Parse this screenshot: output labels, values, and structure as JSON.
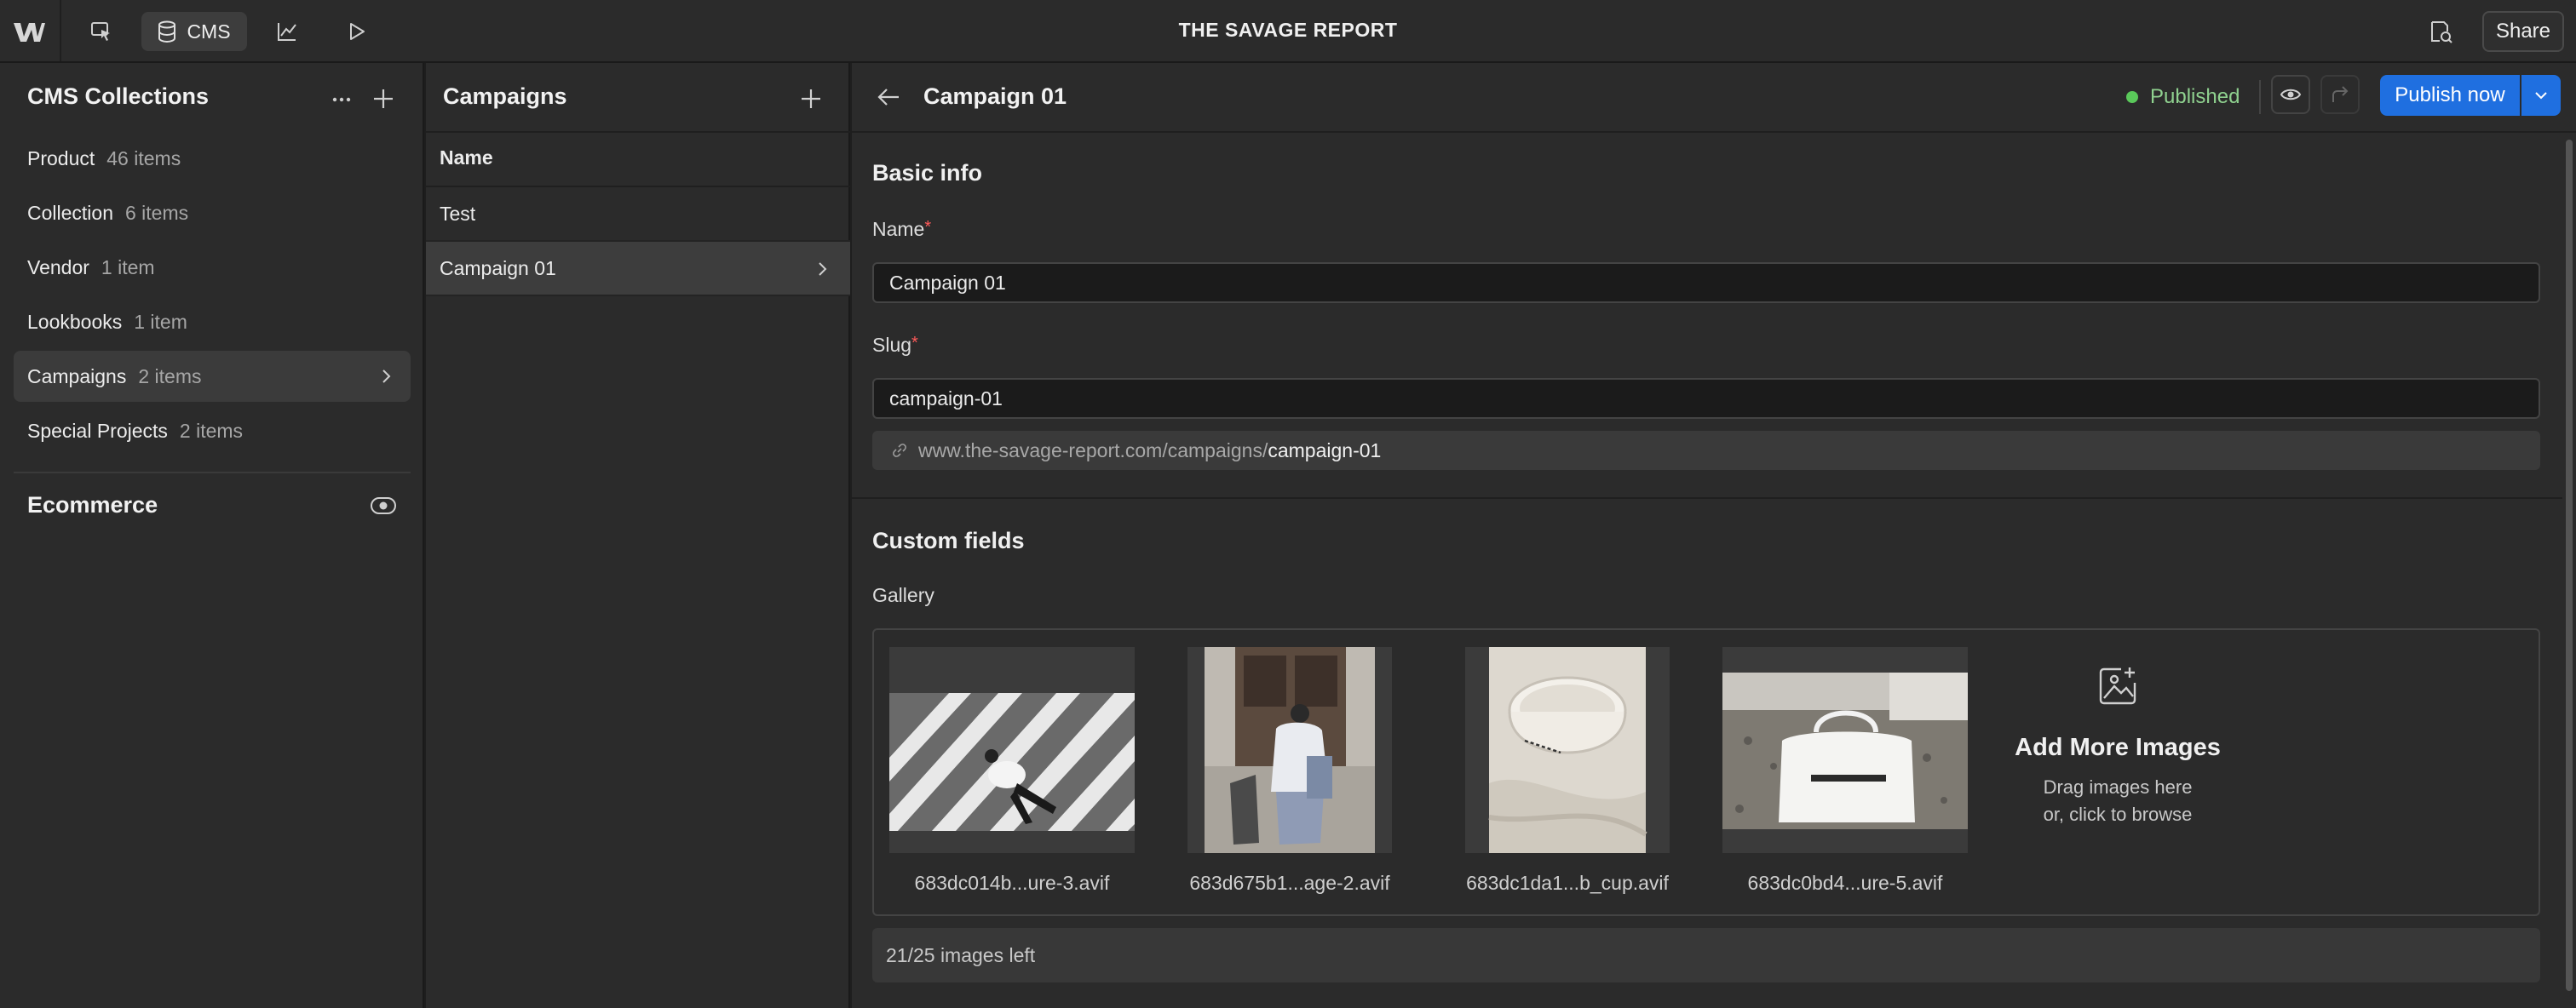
{
  "topbar": {
    "title": "THE SAVAGE REPORT",
    "cms_label": "CMS",
    "share_label": "Share",
    "icons": [
      "webflow-logo",
      "pointer-icon",
      "database-icon",
      "chart-icon",
      "play-icon",
      "comments-icon"
    ]
  },
  "collections_panel": {
    "title": "CMS Collections",
    "items": [
      {
        "name": "Product",
        "count": "46 items"
      },
      {
        "name": "Collection",
        "count": "6 items"
      },
      {
        "name": "Vendor",
        "count": "1 item"
      },
      {
        "name": "Lookbooks",
        "count": "1 item"
      },
      {
        "name": "Campaigns",
        "count": "2 items"
      },
      {
        "name": "Special Projects",
        "count": "2 items"
      }
    ],
    "active_index": 4,
    "ecommerce_label": "Ecommerce"
  },
  "items_panel": {
    "title": "Campaigns",
    "column_header": "Name",
    "rows": [
      "Test",
      "Campaign 01"
    ],
    "active_index": 1
  },
  "editor": {
    "title": "Campaign 01",
    "status": "Published",
    "status_color": "#5ac85a",
    "publish_label": "Publish now",
    "accent_color": "#1f6fe0",
    "basic_info_title": "Basic info",
    "name_label": "Name",
    "name_value": "Campaign 01",
    "slug_label": "Slug",
    "slug_value": "campaign-01",
    "url_prefix": "www.the-savage-report.com/campaigns/",
    "url_slug": "campaign-01",
    "custom_fields_title": "Custom fields",
    "gallery_label": "Gallery",
    "gallery": [
      {
        "filename": "683dc014b...ure-3.avif"
      },
      {
        "filename": "683d675b1...age-2.avif"
      },
      {
        "filename": "683dc1da1...b_cup.avif"
      },
      {
        "filename": "683dc0bd4...ure-5.avif"
      }
    ],
    "add_more_title": "Add More Images",
    "add_more_line1": "Drag images here",
    "add_more_line2": "or, click to browse",
    "images_left": "21/25 images left"
  }
}
